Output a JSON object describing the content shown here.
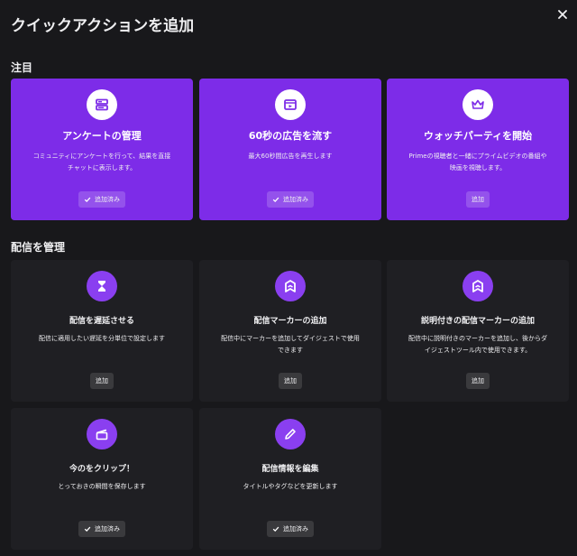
{
  "modal": {
    "title": "クイックアクションを追加"
  },
  "sections": {
    "featured": "注目",
    "manage": "配信を管理"
  },
  "featured": [
    {
      "title": "アンケートの管理",
      "desc": [
        "コミュニティにアンケートを行って、結果を直接",
        "チャットに表示します。"
      ],
      "button": "追加済み",
      "added": true,
      "icon": "poll-icon"
    },
    {
      "title": "60秒の広告を流す",
      "desc": [
        "最大60秒間広告を再生します"
      ],
      "button": "追加済み",
      "added": true,
      "icon": "ad-icon"
    },
    {
      "title": "ウォッチパーティを開始",
      "desc": [
        "Primeの視聴者と一緒にプライムビデオの番組や",
        "映画を視聴します。"
      ],
      "button": "追加",
      "added": false,
      "icon": "crown-icon"
    }
  ],
  "manage": [
    {
      "title": "配信を遅延させる",
      "desc": [
        "配信に適用したい遅延を分単位で設定します"
      ],
      "button": "追加",
      "added": false,
      "icon": "hourglass-icon"
    },
    {
      "title": "配信マーカーの追加",
      "desc": [
        "配信中にマーカーを追加してダイジェストで使用",
        "できます"
      ],
      "button": "追加",
      "added": false,
      "icon": "marker-icon"
    },
    {
      "title": "説明付きの配信マーカーの追加",
      "desc": [
        "配信中に説明付きのマーカーを追加し、後からダ",
        "イジェストツール内で使用できます。"
      ],
      "button": "追加",
      "added": false,
      "icon": "marker-icon"
    },
    {
      "title": "今のをクリップ！",
      "desc": [
        "とっておきの瞬間を保存します"
      ],
      "button": "追加済み",
      "added": true,
      "icon": "clapper-icon"
    },
    {
      "title": "配信情報を編集",
      "desc": [
        "タイトルやタグなどを更新します"
      ],
      "button": "追加済み",
      "added": true,
      "icon": "pencil-icon"
    }
  ],
  "colors": {
    "accent": "#7d2ce8",
    "card": "#1f1f23",
    "background": "#18181b"
  }
}
